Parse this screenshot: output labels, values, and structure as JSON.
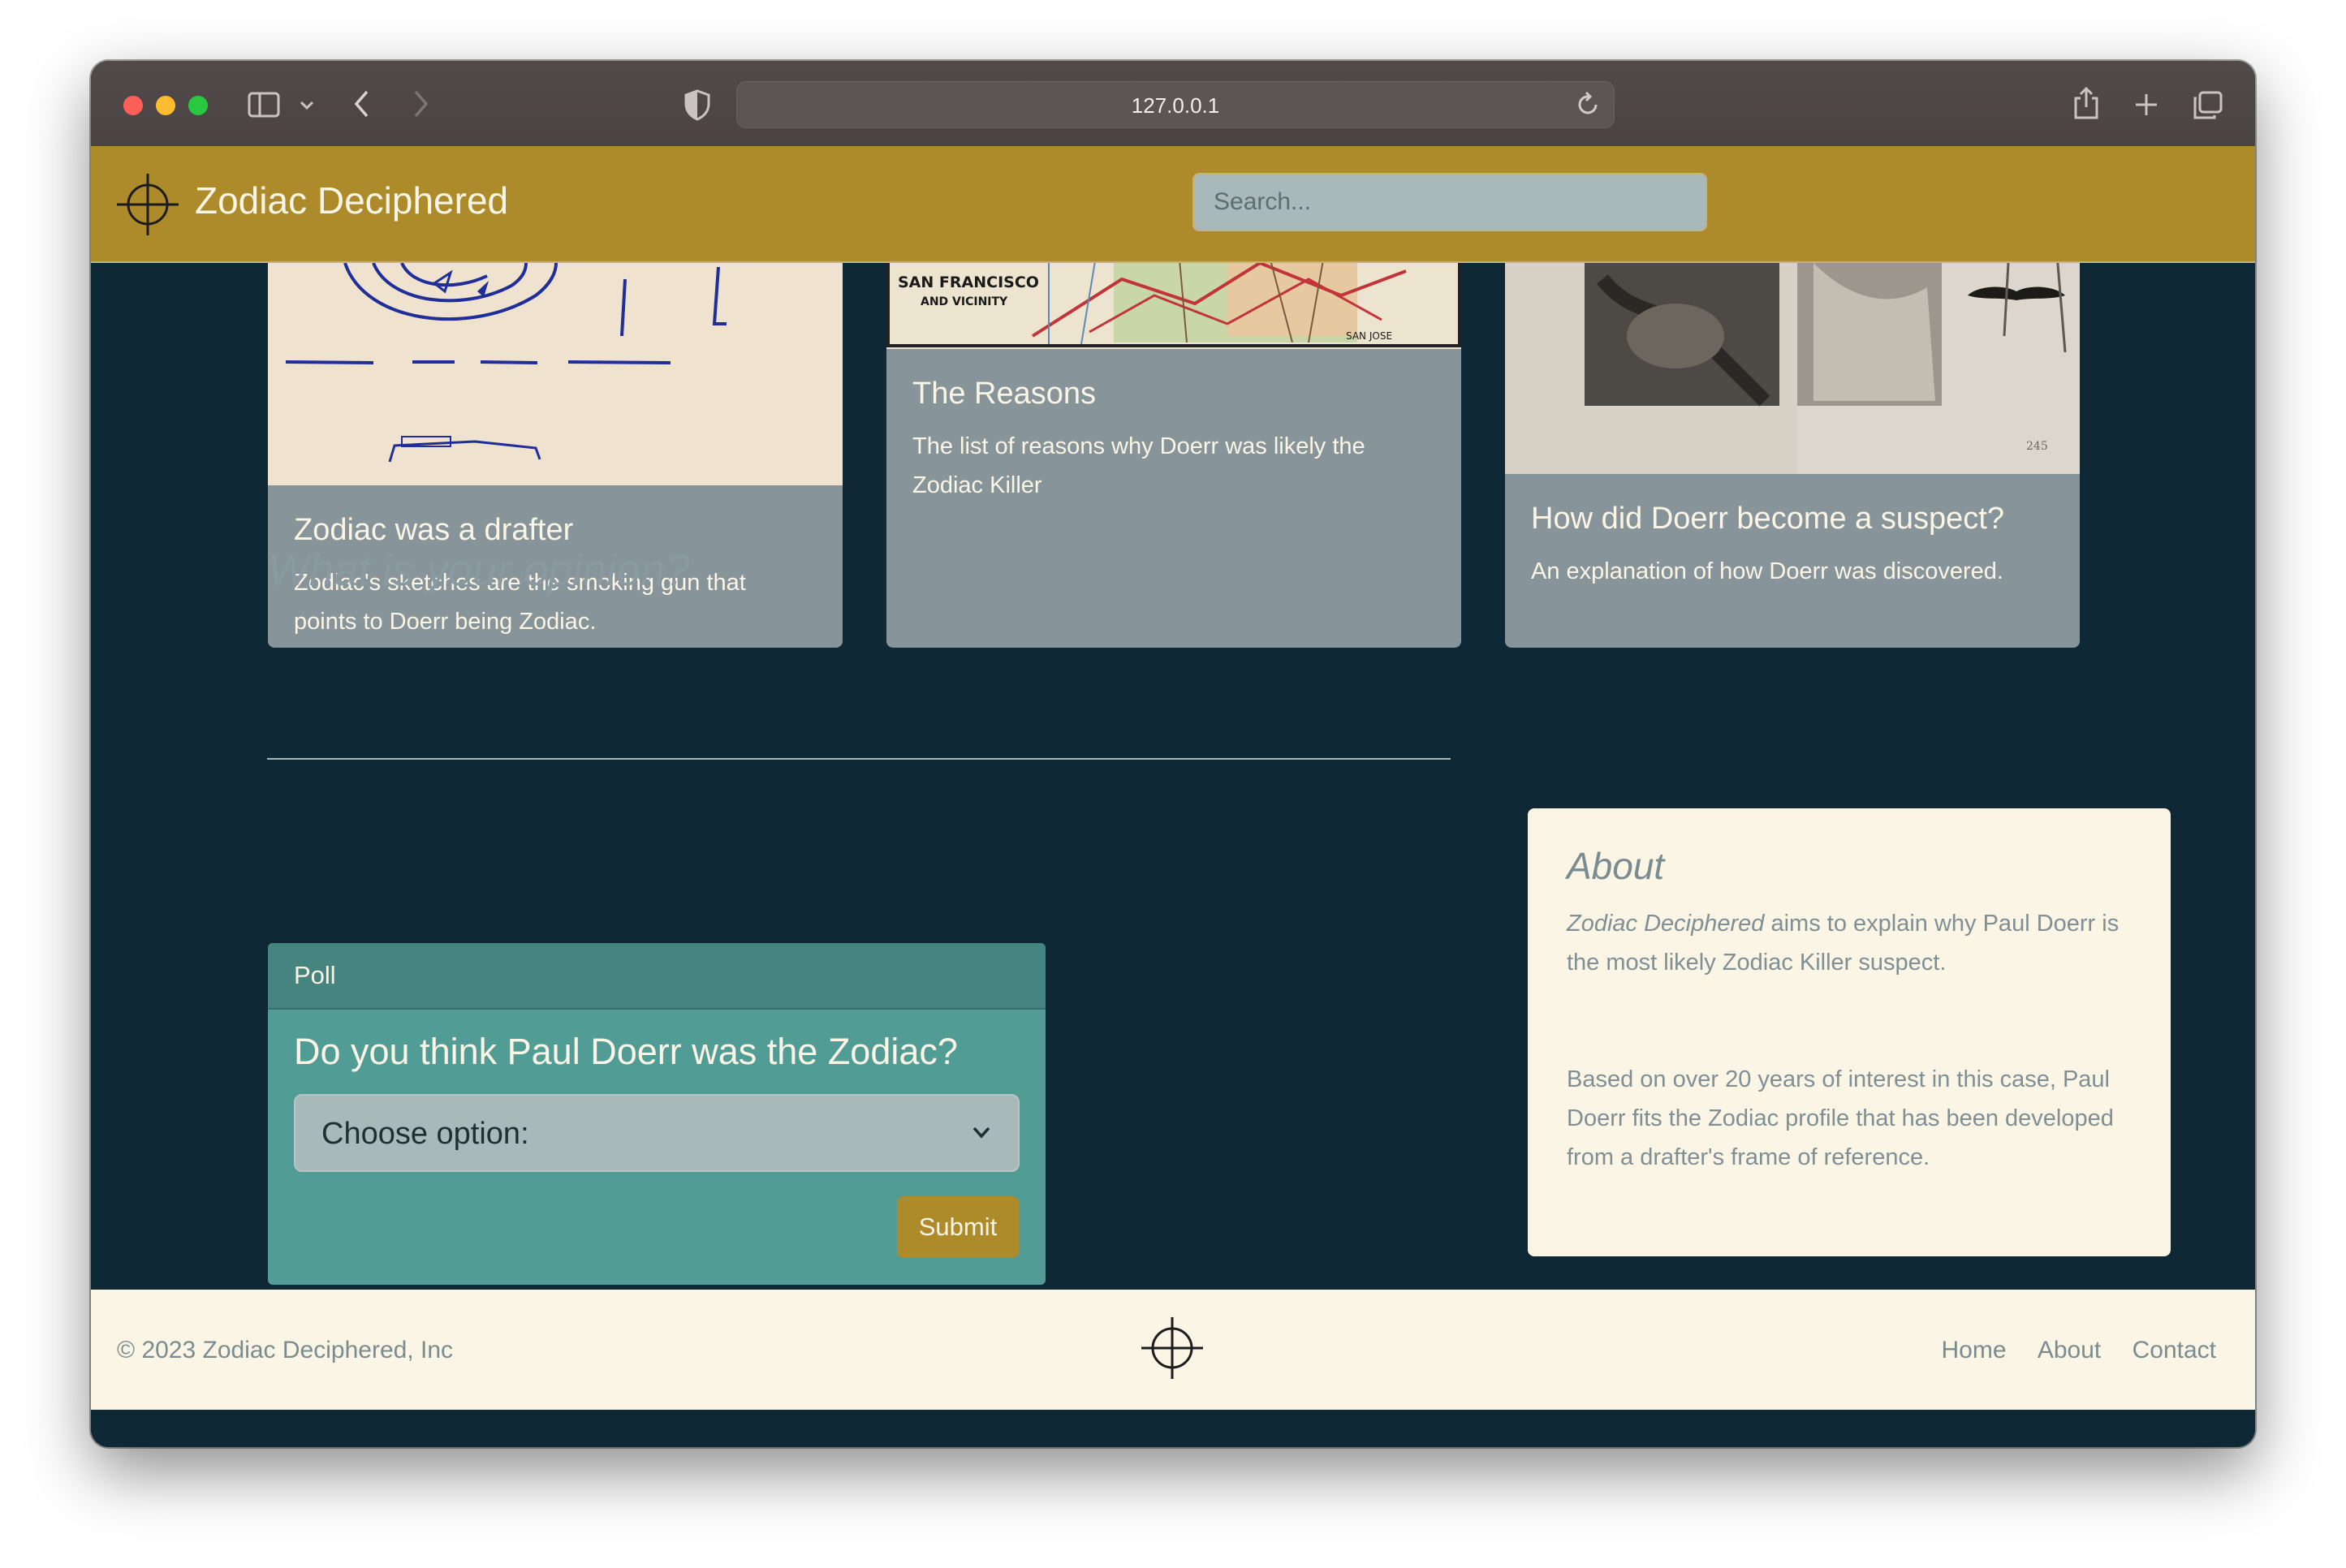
{
  "browser": {
    "url": "127.0.0.1"
  },
  "site": {
    "title": "Zodiac Deciphered",
    "search_placeholder": "Search..."
  },
  "cards": [
    {
      "title": "Zodiac was a drafter",
      "text": "Zodiac's sketches are the smoking gun that points to Doerr being Zodiac."
    },
    {
      "title": "The Reasons",
      "text": "The list of reasons why Doerr was likely the Zodiac Killer",
      "image_label_1": "SAN FRANCISCO",
      "image_label_2": "AND VICINITY",
      "image_label_3": "SAN JOSE"
    },
    {
      "title": "How did Doerr become a suspect?",
      "text": "An explanation of how Doerr was discovered.",
      "image_label_1": "245"
    }
  ],
  "opinion": {
    "heading": "What is your opinion?"
  },
  "poll": {
    "header": "Poll",
    "question": "Do you think Paul Doerr was the Zodiac?",
    "select_value": "Choose option:",
    "submit_label": "Submit"
  },
  "about": {
    "heading": "About",
    "intro_em": "Zodiac Deciphered",
    "intro_rest": " aims to explain why Paul Doerr is the most likely Zodiac Killer suspect.",
    "body": "Based on over 20 years of interest in this case, Paul Doerr fits the Zodiac profile that has been developed from a drafter's frame of reference."
  },
  "footer": {
    "copyright": "© 2023 Zodiac Deciphered, Inc",
    "links": [
      "Home",
      "About",
      "Contact"
    ]
  },
  "colors": {
    "header": "#ad8b2b",
    "background": "#0f2835",
    "card": "#87959a",
    "poll": "#529c96",
    "cream": "#fbf5e6"
  }
}
